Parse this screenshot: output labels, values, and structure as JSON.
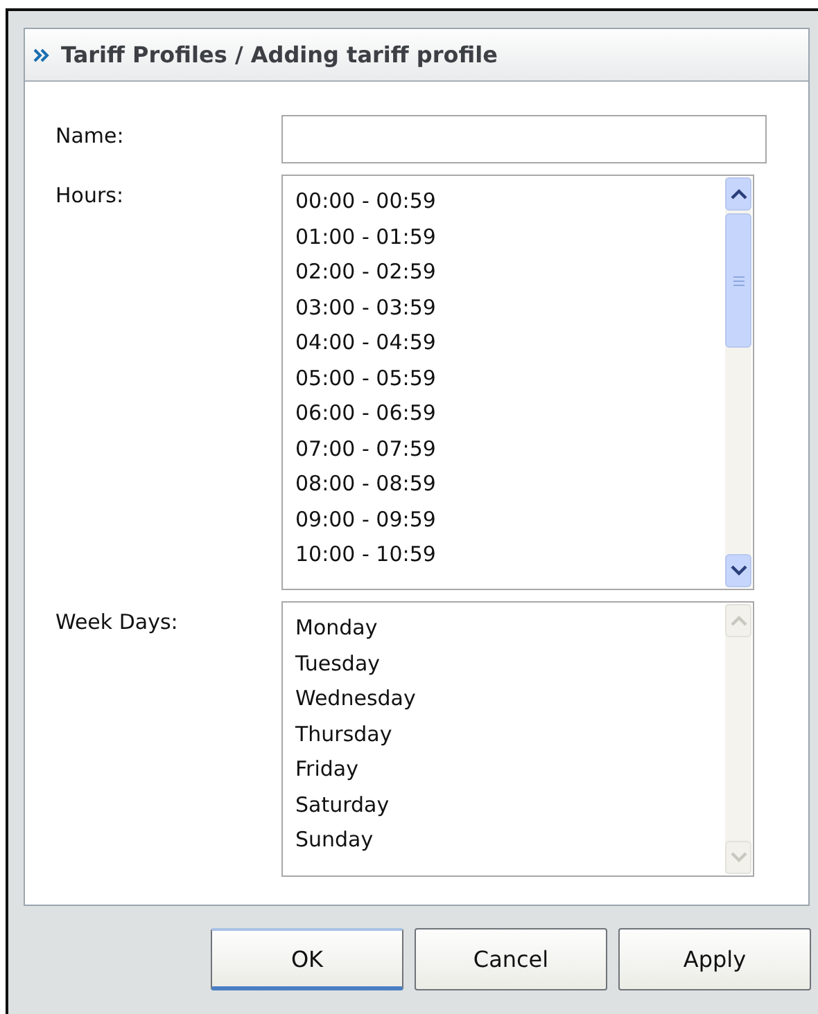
{
  "panel": {
    "title": "Tariff Profiles / Adding tariff profile"
  },
  "fields": [
    {
      "kind": "text",
      "label": "Name:"
    },
    {
      "kind": "list",
      "label": "Hours:",
      "scrollable": true,
      "items": [
        "00:00 - 00:59",
        "01:00 - 01:59",
        "02:00 - 02:59",
        "03:00 - 03:59",
        "04:00 - 04:59",
        "05:00 - 05:59",
        "06:00 - 06:59",
        "07:00 - 07:59",
        "08:00 - 08:59",
        "09:00 - 09:59",
        "10:00 - 10:59"
      ]
    },
    {
      "kind": "list",
      "label": "Week Days:",
      "scrollable": false,
      "items": [
        "Monday",
        "Tuesday",
        "Wednesday",
        "Thursday",
        "Friday",
        "Saturday",
        "Sunday"
      ]
    }
  ],
  "buttons": [
    {
      "label": "OK",
      "selected": true
    },
    {
      "label": "Cancel",
      "selected": false
    },
    {
      "label": "Apply",
      "selected": false
    }
  ]
}
